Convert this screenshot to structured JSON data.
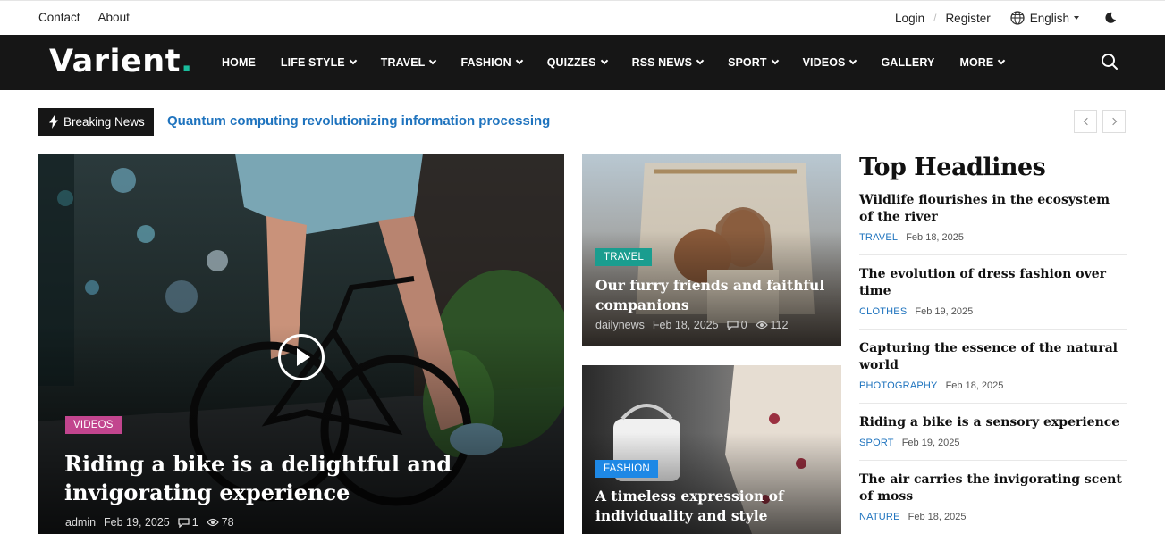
{
  "topbar": {
    "left_links": [
      "Contact",
      "About"
    ],
    "login": "Login",
    "divider": "/",
    "register": "Register",
    "language": "English"
  },
  "nav": {
    "logo_text": "Varient",
    "logo_dot": ".",
    "items": [
      {
        "label": "HOME",
        "dropdown": false
      },
      {
        "label": "LIFE STYLE",
        "dropdown": true
      },
      {
        "label": "TRAVEL",
        "dropdown": true
      },
      {
        "label": "FASHION",
        "dropdown": true
      },
      {
        "label": "QUIZZES",
        "dropdown": true
      },
      {
        "label": "RSS NEWS",
        "dropdown": true
      },
      {
        "label": "SPORT",
        "dropdown": true
      },
      {
        "label": "VIDEOS",
        "dropdown": true
      },
      {
        "label": "GALLERY",
        "dropdown": false
      },
      {
        "label": "MORE",
        "dropdown": true
      }
    ]
  },
  "breaking": {
    "label": "Breaking News",
    "headline": "Quantum computing revolutionizing information processing"
  },
  "feature": {
    "category": "VIDEOS",
    "category_color": "#c2458e",
    "title": "Riding a bike is a delightful and invigorating experience",
    "author": "admin",
    "date": "Feb 19, 2025",
    "comments": "1",
    "views": "78"
  },
  "cards": [
    {
      "category": "TRAVEL",
      "category_color": "#1a9d8f",
      "title": "Our furry friends and faithful companions",
      "author": "dailynews",
      "date": "Feb 18, 2025",
      "comments": "0",
      "views": "112"
    },
    {
      "category": "FASHION",
      "category_color": "#1e88e5",
      "title": "A timeless expression of individuality and style"
    }
  ],
  "headlines": {
    "heading": "Top Headlines",
    "items": [
      {
        "title": "Wildlife flourishes in the ecosystem of the river",
        "category": "TRAVEL",
        "date": "Feb 18, 2025"
      },
      {
        "title": "The evolution of dress fashion over time",
        "category": "CLOTHES",
        "date": "Feb 19, 2025"
      },
      {
        "title": "Capturing the essence of the natural world",
        "category": "PHOTOGRAPHY",
        "date": "Feb 18, 2025"
      },
      {
        "title": "Riding a bike is a sensory experience",
        "category": "SPORT",
        "date": "Feb 19, 2025"
      },
      {
        "title": "The air carries the invigorating scent of moss",
        "category": "NATURE",
        "date": "Feb 18, 2025"
      }
    ]
  },
  "accent_color": "#1e73be"
}
